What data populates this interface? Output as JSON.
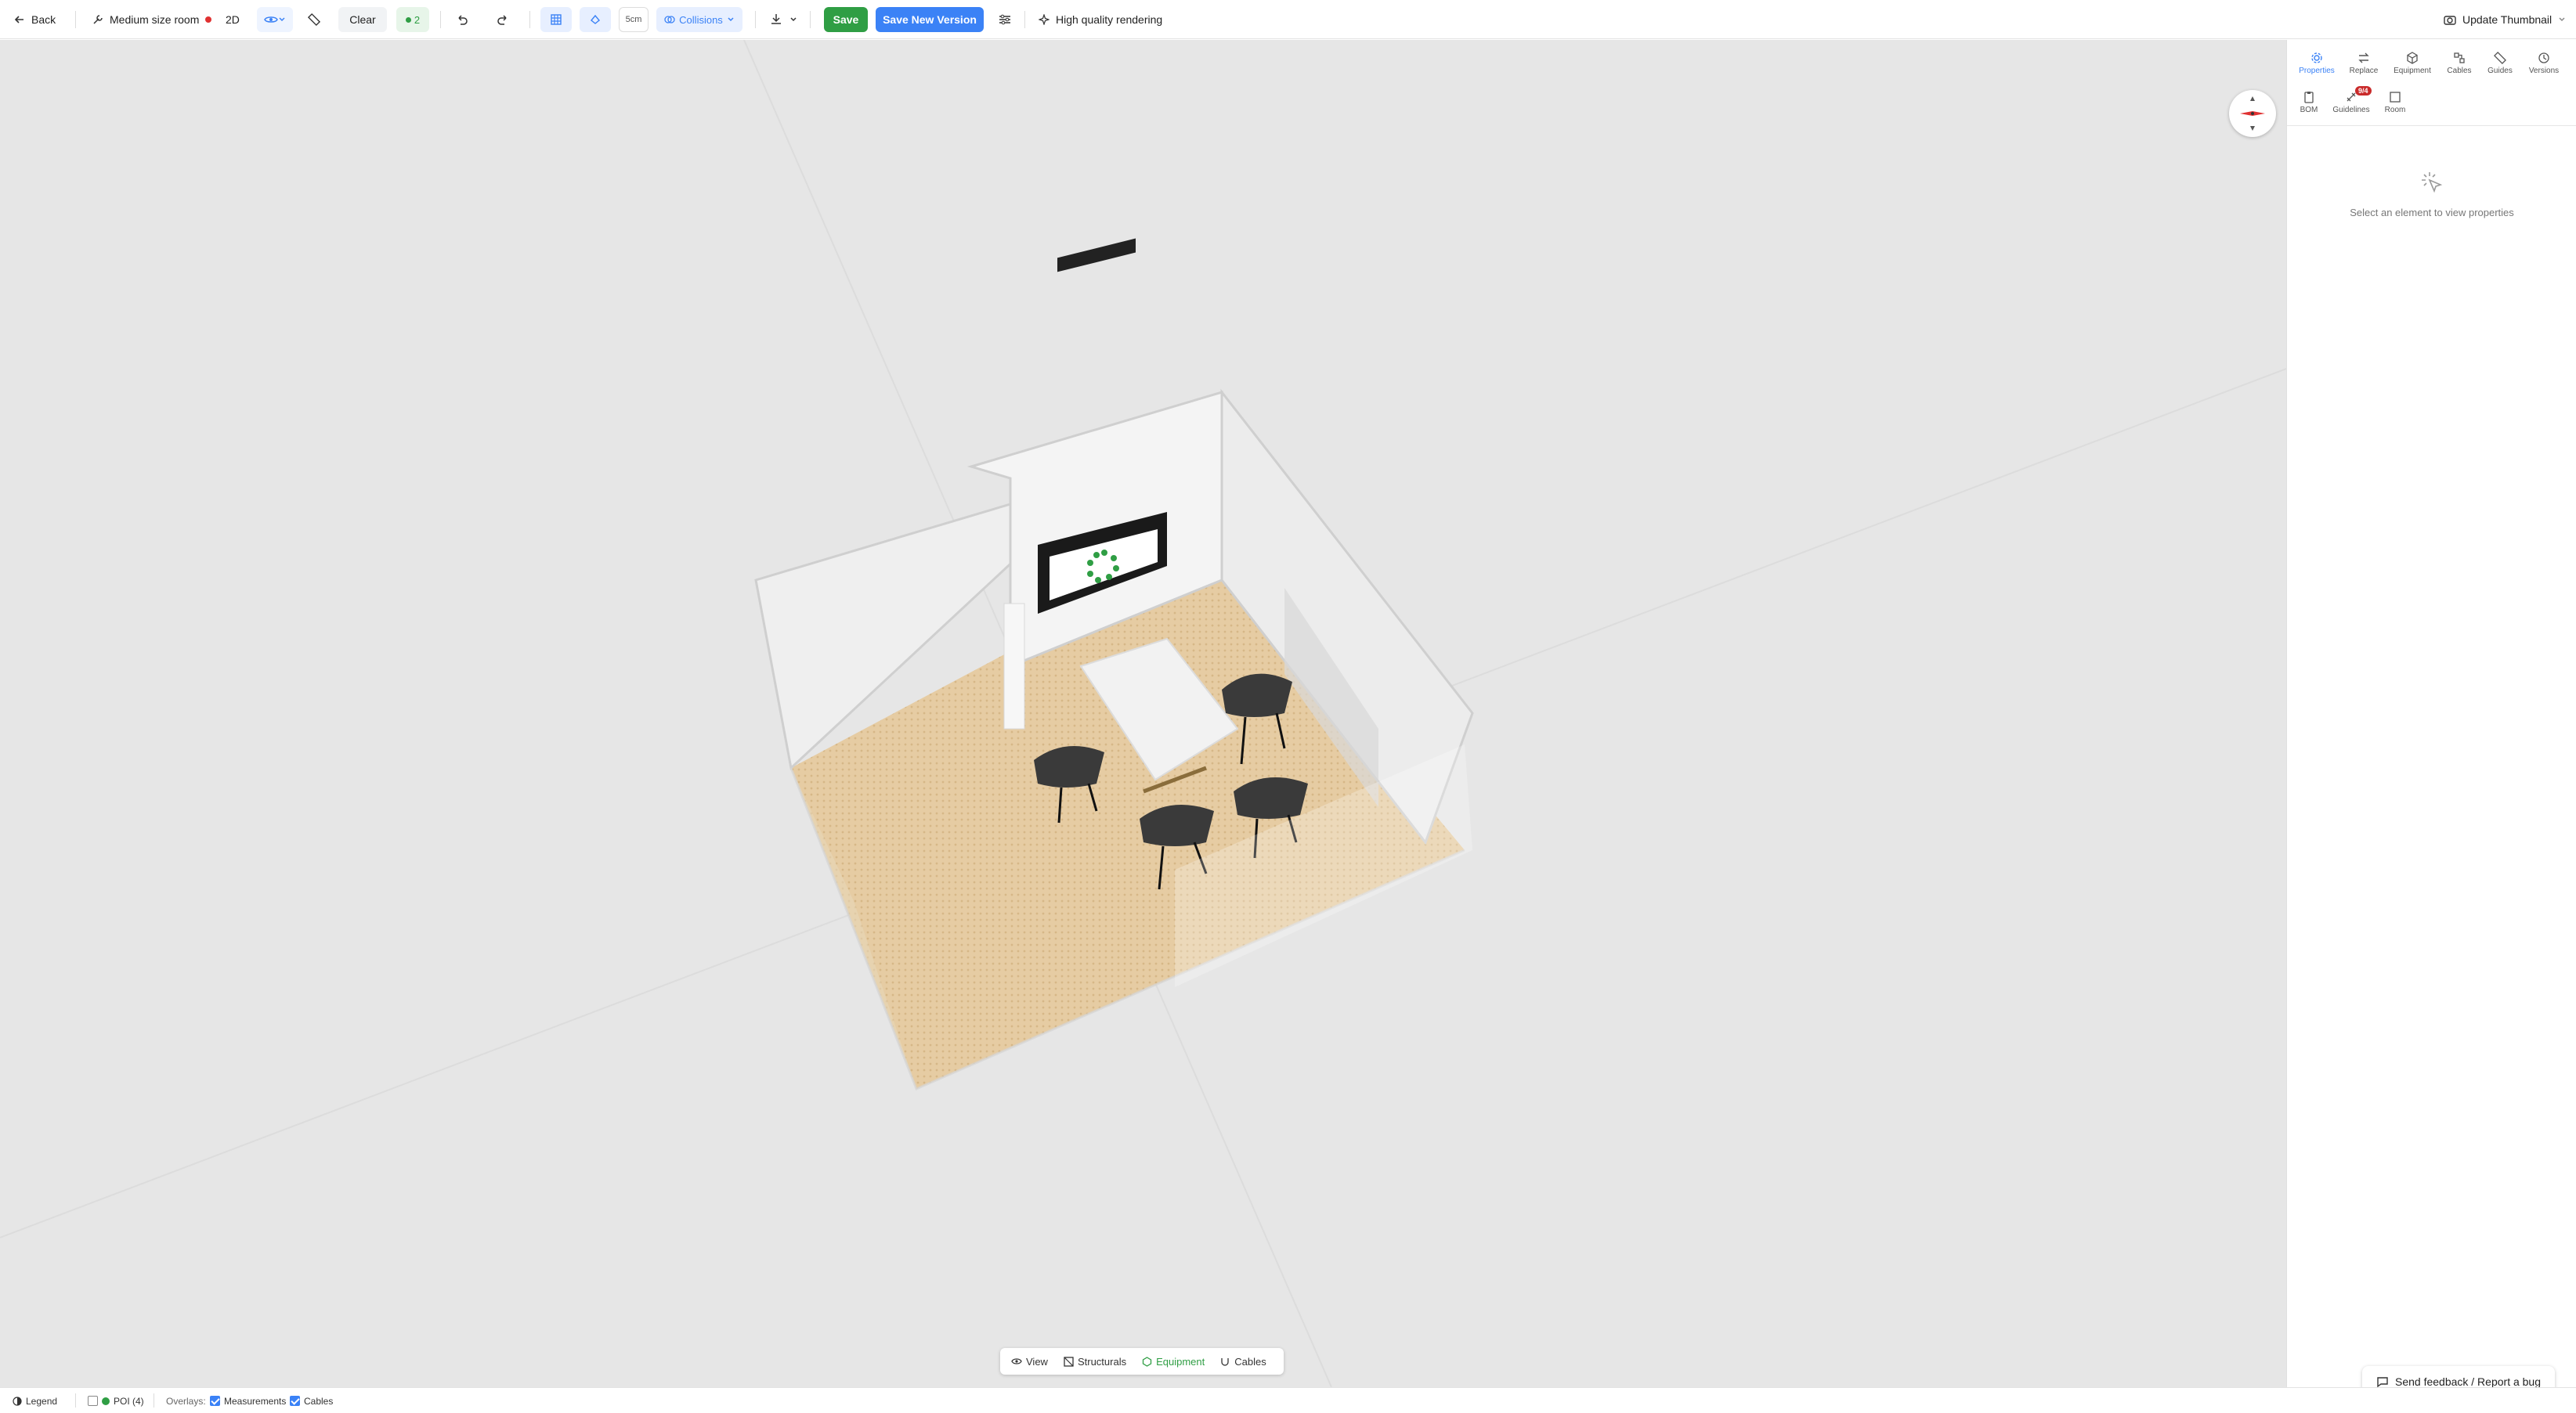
{
  "toolbar": {
    "back_label": "Back",
    "room_name": "Medium size room",
    "unsaved_color": "#e03131",
    "view_mode": "2D",
    "clear_label": "Clear",
    "count_badge": "2",
    "grid_size": "5cm",
    "collisions_label": "Collisions",
    "save_label": "Save",
    "save_new_version_label": "Save New Version",
    "hq_render_label": "High quality rendering",
    "update_thumbnail_label": "Update Thumbnail"
  },
  "panel": {
    "tabs": [
      {
        "label": "Properties",
        "icon": "gear-icon",
        "active": true
      },
      {
        "label": "Replace",
        "icon": "swap-icon"
      },
      {
        "label": "Equipment",
        "icon": "box-icon"
      },
      {
        "label": "Cables",
        "icon": "cable-icon"
      },
      {
        "label": "Guides",
        "icon": "ruler-icon"
      },
      {
        "label": "Versions",
        "icon": "history-icon"
      },
      {
        "label": "BOM",
        "icon": "clipboard-icon"
      },
      {
        "label": "Guidelines",
        "icon": "guidelines-icon",
        "badge": "9/4"
      },
      {
        "label": "Room",
        "icon": "room-icon"
      }
    ],
    "empty_message": "Select an element to view properties"
  },
  "bottom_tabs": [
    {
      "label": "View",
      "icon": "eye-icon"
    },
    {
      "label": "Structurals",
      "icon": "structurals-icon"
    },
    {
      "label": "Equipment",
      "icon": "equipment-icon",
      "active": true
    },
    {
      "label": "Cables",
      "icon": "cables-icon"
    }
  ],
  "feedback_label": "Send feedback / Report a bug",
  "status": {
    "legend_label": "Legend",
    "poi_label": "POI (4)",
    "overlays_label": "Overlays:",
    "measurements_label": "Measurements",
    "cables_label": "Cables"
  },
  "colors": {
    "accent_green": "#2f9e44",
    "accent_blue": "#3b82f6",
    "floor": "#e4c9a0",
    "viewport_bg": "#e6e6e6"
  }
}
